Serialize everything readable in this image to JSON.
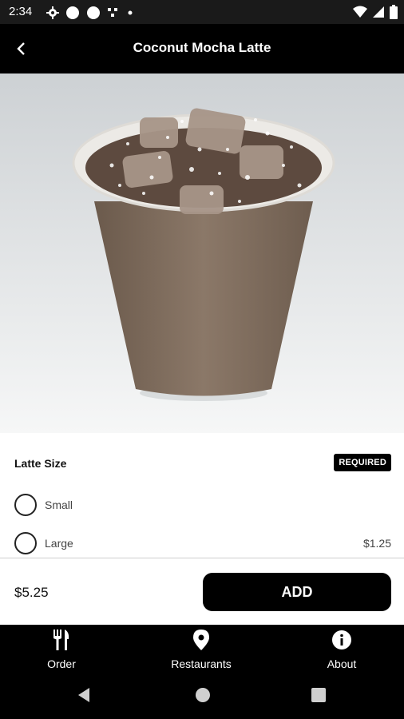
{
  "status_bar": {
    "time": "2:34"
  },
  "app_bar": {
    "title": "Coconut Mocha Latte"
  },
  "options": {
    "section_title": "Latte Size",
    "required_badge": "REQUIRED",
    "items": [
      {
        "label": "Small",
        "price": ""
      },
      {
        "label": "Large",
        "price": "$1.25"
      }
    ]
  },
  "footer": {
    "total": "$5.25",
    "add_label": "ADD"
  },
  "bottom_nav": {
    "items": [
      {
        "label": "Order",
        "icon": "fork-knife-icon"
      },
      {
        "label": "Restaurants",
        "icon": "map-pin-icon"
      },
      {
        "label": "About",
        "icon": "info-icon"
      }
    ]
  },
  "colors": {
    "primary": "#000000",
    "background": "#ffffff",
    "status_bar": "#1a1a1a"
  }
}
